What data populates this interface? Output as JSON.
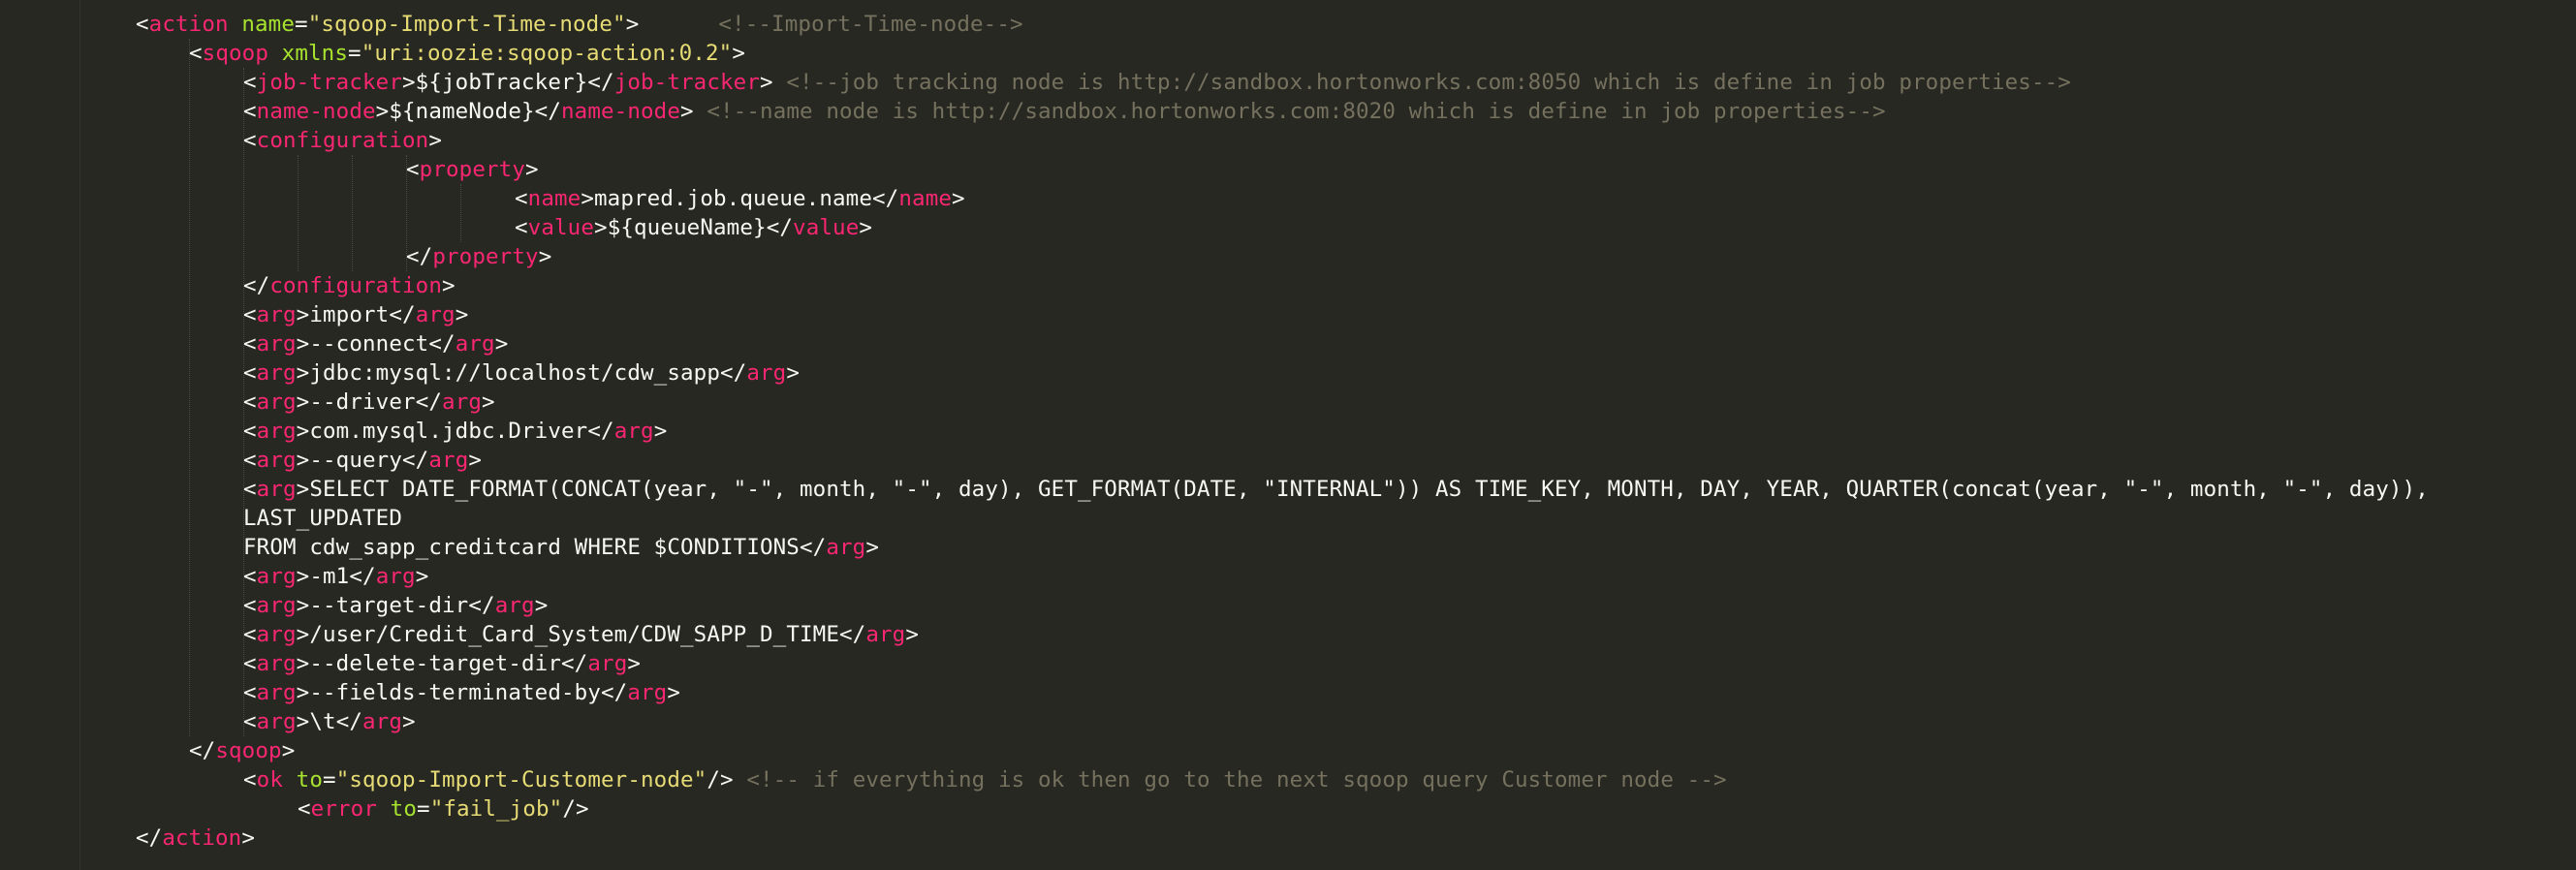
{
  "editor": {
    "theme_colors": {
      "background": "#272822",
      "tag": "#f92672",
      "attribute": "#a6e22e",
      "string": "#e6db74",
      "text": "#f8f8f2",
      "comment": "#75715e"
    },
    "lines": [
      [
        {
          "k": "p",
          "v": "<"
        },
        {
          "k": "t",
          "v": "action"
        },
        {
          "k": "a",
          "v": " name"
        },
        {
          "k": "p",
          "v": "="
        },
        {
          "k": "s",
          "v": "\"sqoop-Import-Time-node\""
        },
        {
          "k": "p",
          "v": ">"
        },
        {
          "k": "x",
          "v": "      "
        },
        {
          "k": "c",
          "v": "<!--Import-Time-node-->"
        }
      ],
      [
        {
          "k": "p",
          "v": "<"
        },
        {
          "k": "t",
          "v": "sqoop"
        },
        {
          "k": "a",
          "v": " xmlns"
        },
        {
          "k": "p",
          "v": "="
        },
        {
          "k": "s",
          "v": "\"uri:oozie:sqoop-action:0.2\""
        },
        {
          "k": "p",
          "v": ">"
        }
      ],
      [
        {
          "k": "p",
          "v": "<"
        },
        {
          "k": "t",
          "v": "job-tracker"
        },
        {
          "k": "p",
          "v": ">"
        },
        {
          "k": "x",
          "v": "${jobTracker}"
        },
        {
          "k": "p",
          "v": "</"
        },
        {
          "k": "t",
          "v": "job-tracker"
        },
        {
          "k": "p",
          "v": ">"
        },
        {
          "k": "x",
          "v": " "
        },
        {
          "k": "c",
          "v": "<!--job tracking node is http://sandbox.hortonworks.com:8050 which is define in job properties-->"
        }
      ],
      [
        {
          "k": "p",
          "v": "<"
        },
        {
          "k": "t",
          "v": "name-node"
        },
        {
          "k": "p",
          "v": ">"
        },
        {
          "k": "x",
          "v": "${nameNode}"
        },
        {
          "k": "p",
          "v": "</"
        },
        {
          "k": "t",
          "v": "name-node"
        },
        {
          "k": "p",
          "v": ">"
        },
        {
          "k": "x",
          "v": " "
        },
        {
          "k": "c",
          "v": "<!--name node is http://sandbox.hortonworks.com:8020 which is define in job properties-->"
        }
      ],
      [
        {
          "k": "p",
          "v": "<"
        },
        {
          "k": "t",
          "v": "configuration"
        },
        {
          "k": "p",
          "v": ">"
        }
      ],
      [
        {
          "k": "p",
          "v": "<"
        },
        {
          "k": "t",
          "v": "property"
        },
        {
          "k": "p",
          "v": ">"
        }
      ],
      [
        {
          "k": "p",
          "v": "<"
        },
        {
          "k": "t",
          "v": "name"
        },
        {
          "k": "p",
          "v": ">"
        },
        {
          "k": "x",
          "v": "mapred.job.queue.name"
        },
        {
          "k": "p",
          "v": "</"
        },
        {
          "k": "t",
          "v": "name"
        },
        {
          "k": "p",
          "v": ">"
        }
      ],
      [
        {
          "k": "p",
          "v": "<"
        },
        {
          "k": "t",
          "v": "value"
        },
        {
          "k": "p",
          "v": ">"
        },
        {
          "k": "x",
          "v": "${queueName}"
        },
        {
          "k": "p",
          "v": "</"
        },
        {
          "k": "t",
          "v": "value"
        },
        {
          "k": "p",
          "v": ">"
        }
      ],
      [
        {
          "k": "p",
          "v": "</"
        },
        {
          "k": "t",
          "v": "property"
        },
        {
          "k": "p",
          "v": ">"
        }
      ],
      [
        {
          "k": "p",
          "v": "</"
        },
        {
          "k": "t",
          "v": "configuration"
        },
        {
          "k": "p",
          "v": ">"
        }
      ],
      [
        {
          "k": "p",
          "v": "<"
        },
        {
          "k": "t",
          "v": "arg"
        },
        {
          "k": "p",
          "v": ">"
        },
        {
          "k": "x",
          "v": "import"
        },
        {
          "k": "p",
          "v": "</"
        },
        {
          "k": "t",
          "v": "arg"
        },
        {
          "k": "p",
          "v": ">"
        }
      ],
      [
        {
          "k": "p",
          "v": "<"
        },
        {
          "k": "t",
          "v": "arg"
        },
        {
          "k": "p",
          "v": ">"
        },
        {
          "k": "x",
          "v": "--connect"
        },
        {
          "k": "p",
          "v": "</"
        },
        {
          "k": "t",
          "v": "arg"
        },
        {
          "k": "p",
          "v": ">"
        }
      ],
      [
        {
          "k": "p",
          "v": "<"
        },
        {
          "k": "t",
          "v": "arg"
        },
        {
          "k": "p",
          "v": ">"
        },
        {
          "k": "x",
          "v": "jdbc:mysql://localhost/cdw_sapp"
        },
        {
          "k": "p",
          "v": "</"
        },
        {
          "k": "t",
          "v": "arg"
        },
        {
          "k": "p",
          "v": ">"
        }
      ],
      [
        {
          "k": "p",
          "v": "<"
        },
        {
          "k": "t",
          "v": "arg"
        },
        {
          "k": "p",
          "v": ">"
        },
        {
          "k": "x",
          "v": "--driver"
        },
        {
          "k": "p",
          "v": "</"
        },
        {
          "k": "t",
          "v": "arg"
        },
        {
          "k": "p",
          "v": ">"
        }
      ],
      [
        {
          "k": "p",
          "v": "<"
        },
        {
          "k": "t",
          "v": "arg"
        },
        {
          "k": "p",
          "v": ">"
        },
        {
          "k": "x",
          "v": "com.mysql.jdbc.Driver"
        },
        {
          "k": "p",
          "v": "</"
        },
        {
          "k": "t",
          "v": "arg"
        },
        {
          "k": "p",
          "v": ">"
        }
      ],
      [
        {
          "k": "p",
          "v": "<"
        },
        {
          "k": "t",
          "v": "arg"
        },
        {
          "k": "p",
          "v": ">"
        },
        {
          "k": "x",
          "v": "--query"
        },
        {
          "k": "p",
          "v": "</"
        },
        {
          "k": "t",
          "v": "arg"
        },
        {
          "k": "p",
          "v": ">"
        }
      ],
      [
        {
          "k": "p",
          "v": "<"
        },
        {
          "k": "t",
          "v": "arg"
        },
        {
          "k": "p",
          "v": ">"
        },
        {
          "k": "x",
          "v": "SELECT DATE_FORMAT(CONCAT(year, \"-\", month, \"-\", day), GET_FORMAT(DATE, \"INTERNAL\")) AS TIME_KEY, MONTH, DAY, YEAR, QUARTER(concat(year, \"-\", month, \"-\", day)),"
        }
      ],
      [
        {
          "k": "x",
          "v": "LAST_UPDATED"
        }
      ],
      [
        {
          "k": "x",
          "v": "FROM cdw_sapp_creditcard WHERE $CONDITIONS"
        },
        {
          "k": "p",
          "v": "</"
        },
        {
          "k": "t",
          "v": "arg"
        },
        {
          "k": "p",
          "v": ">"
        }
      ],
      [
        {
          "k": "p",
          "v": "<"
        },
        {
          "k": "t",
          "v": "arg"
        },
        {
          "k": "p",
          "v": ">"
        },
        {
          "k": "x",
          "v": "-m1"
        },
        {
          "k": "p",
          "v": "</"
        },
        {
          "k": "t",
          "v": "arg"
        },
        {
          "k": "p",
          "v": ">"
        }
      ],
      [
        {
          "k": "p",
          "v": "<"
        },
        {
          "k": "t",
          "v": "arg"
        },
        {
          "k": "p",
          "v": ">"
        },
        {
          "k": "x",
          "v": "--target-dir"
        },
        {
          "k": "p",
          "v": "</"
        },
        {
          "k": "t",
          "v": "arg"
        },
        {
          "k": "p",
          "v": ">"
        }
      ],
      [
        {
          "k": "p",
          "v": "<"
        },
        {
          "k": "t",
          "v": "arg"
        },
        {
          "k": "p",
          "v": ">"
        },
        {
          "k": "x",
          "v": "/user/Credit_Card_System/CDW_SAPP_D_TIME"
        },
        {
          "k": "p",
          "v": "</"
        },
        {
          "k": "t",
          "v": "arg"
        },
        {
          "k": "p",
          "v": ">"
        }
      ],
      [
        {
          "k": "p",
          "v": "<"
        },
        {
          "k": "t",
          "v": "arg"
        },
        {
          "k": "p",
          "v": ">"
        },
        {
          "k": "x",
          "v": "--delete-target-dir"
        },
        {
          "k": "p",
          "v": "</"
        },
        {
          "k": "t",
          "v": "arg"
        },
        {
          "k": "p",
          "v": ">"
        }
      ],
      [
        {
          "k": "p",
          "v": "<"
        },
        {
          "k": "t",
          "v": "arg"
        },
        {
          "k": "p",
          "v": ">"
        },
        {
          "k": "x",
          "v": "--fields-terminated-by"
        },
        {
          "k": "p",
          "v": "</"
        },
        {
          "k": "t",
          "v": "arg"
        },
        {
          "k": "p",
          "v": ">"
        }
      ],
      [
        {
          "k": "p",
          "v": "<"
        },
        {
          "k": "t",
          "v": "arg"
        },
        {
          "k": "p",
          "v": ">"
        },
        {
          "k": "x",
          "v": "\\t"
        },
        {
          "k": "p",
          "v": "</"
        },
        {
          "k": "t",
          "v": "arg"
        },
        {
          "k": "p",
          "v": ">"
        }
      ],
      [
        {
          "k": "p",
          "v": "</"
        },
        {
          "k": "t",
          "v": "sqoop"
        },
        {
          "k": "p",
          "v": ">"
        }
      ],
      [
        {
          "k": "p",
          "v": "<"
        },
        {
          "k": "t",
          "v": "ok"
        },
        {
          "k": "a",
          "v": " to"
        },
        {
          "k": "p",
          "v": "="
        },
        {
          "k": "s",
          "v": "\"sqoop-Import-Customer-node\""
        },
        {
          "k": "p",
          "v": "/>"
        },
        {
          "k": "x",
          "v": " "
        },
        {
          "k": "c",
          "v": "<!-- if everything is ok then go to the next sqoop query Customer node -->"
        }
      ],
      [
        {
          "k": "p",
          "v": "<"
        },
        {
          "k": "t",
          "v": "error"
        },
        {
          "k": "a",
          "v": " to"
        },
        {
          "k": "p",
          "v": "="
        },
        {
          "k": "s",
          "v": "\"fail_job\""
        },
        {
          "k": "p",
          "v": "/>"
        }
      ],
      [
        {
          "k": "p",
          "v": "</"
        },
        {
          "k": "t",
          "v": "action"
        },
        {
          "k": "p",
          "v": ">"
        }
      ]
    ]
  }
}
